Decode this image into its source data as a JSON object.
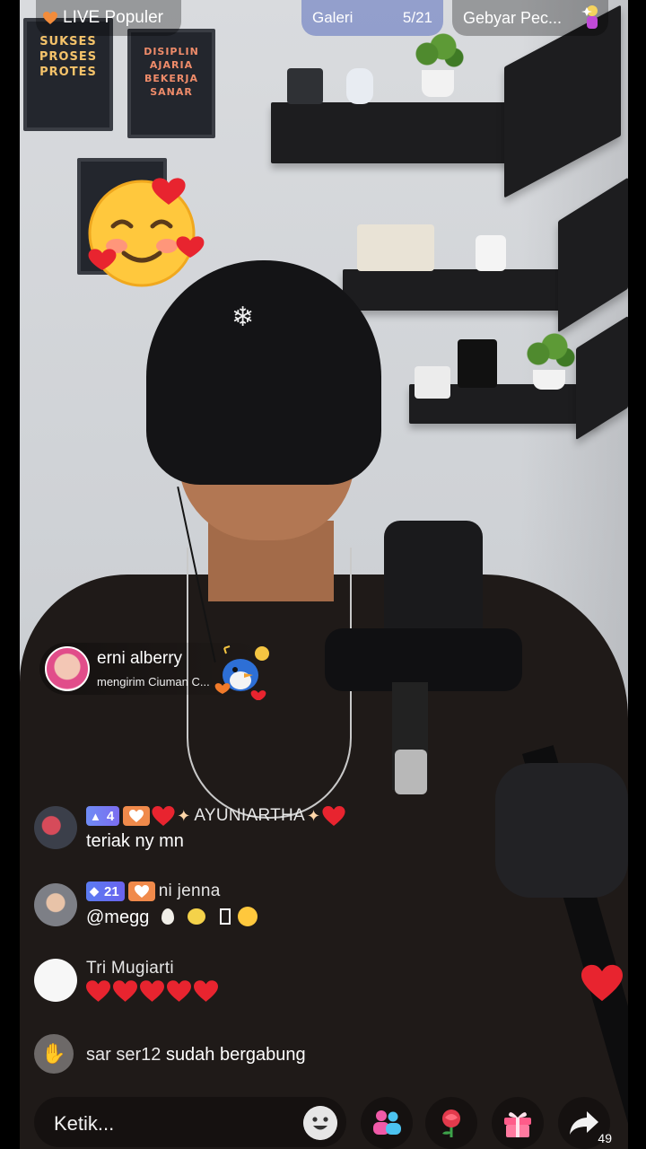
{
  "top": {
    "live_label": "LIVE Populer",
    "gallery_label": "Galeri",
    "gallery_count": "5/21",
    "event_label": "Gebyar Pec..."
  },
  "gift": {
    "sender": "erni alberry",
    "message": "mengirim Ciuman C..."
  },
  "comments": [
    {
      "level": "4",
      "user": "AYUNIARTHA",
      "text": "teriak ny mn"
    },
    {
      "level": "21",
      "user": "ni jenna",
      "text": "@megg"
    },
    {
      "user": "Tri Mugiarti"
    }
  ],
  "join": {
    "user": "sar ser12",
    "text": "sudah bergabung"
  },
  "input": {
    "placeholder": "Ketik..."
  },
  "share": {
    "count": "49"
  },
  "colors": {
    "accent_orange": "#f08a4b",
    "level_badge": "#6f8cf5",
    "heart_red": "#e8242f"
  },
  "icons": [
    "heart-icon",
    "fairy-icon",
    "emoji-icon",
    "co-host-icon",
    "rose-icon",
    "gift-icon",
    "share-icon",
    "wave-hand-icon"
  ]
}
